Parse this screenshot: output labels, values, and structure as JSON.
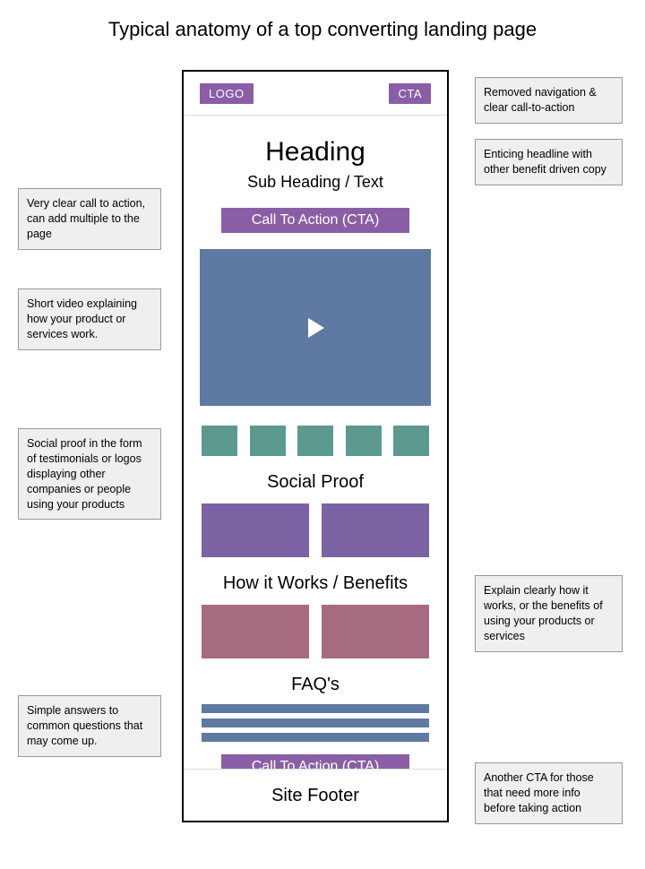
{
  "title": "Typical anatomy of a top converting landing page",
  "topbar": {
    "logo": "LOGO",
    "cta": "CTA"
  },
  "heading": "Heading",
  "subheading": "Sub Heading / Text",
  "cta_label": "Call To Action (CTA)",
  "sections": {
    "social_proof": "Social Proof",
    "how_it_works": "How it Works / Benefits",
    "faqs": "FAQ's"
  },
  "footer": "Site Footer",
  "notes": {
    "nav": "Removed navigation & clear call-to-action",
    "head": "Enticing headline with other benefit driven copy",
    "cta1": "Very clear call to action, can add multiple to the page",
    "video": "Short video explaining how your product or services work.",
    "proof": "Social proof in the form of testimonials or logos displaying other companies or people using your products",
    "how": "Explain clearly how it works, or the benefits of using your products or services",
    "faq": "Simple answers to common questions that may come up.",
    "cta2": "Another CTA for those that need more info before taking action"
  },
  "colors": {
    "purple": "#8a5ea5",
    "slate": "#5e7aa2",
    "teal": "#5c9a8f",
    "violet": "#7b62a3",
    "mauve": "#a76b81"
  }
}
